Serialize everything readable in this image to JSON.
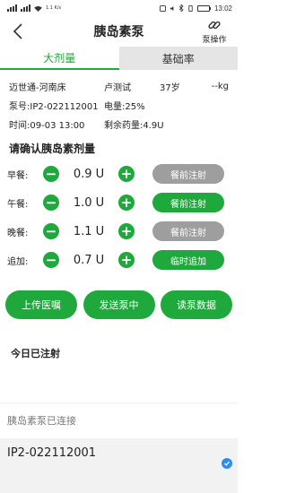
{
  "status_bar": {
    "left_text": "1.1 K/s",
    "time": "13:02",
    "battery_fill": 0.8
  },
  "header": {
    "title": "胰岛素泵",
    "pump_op_label": "泵操作"
  },
  "tabs": [
    {
      "label": "大剂量",
      "active": true
    },
    {
      "label": "基础率",
      "active": false
    }
  ],
  "patient": {
    "name": "迈世通-河南床",
    "test": "卢测试",
    "age": "37岁",
    "weight": "--kg",
    "pump_no": "泵号:IP2-022112001",
    "battery": "电量:25%",
    "time": "时间:09-03 13:00",
    "remaining": "剩余药量:4.9U"
  },
  "dose_section": {
    "title": "请确认胰岛素剂量",
    "rows": [
      {
        "label": "早餐:",
        "value": "0.9",
        "unit": "U",
        "action": "餐前注射",
        "action_state": "gray"
      },
      {
        "label": "午餐:",
        "value": "1.0",
        "unit": "U",
        "action": "餐前注射",
        "action_state": "green"
      },
      {
        "label": "晚餐:",
        "value": "1.1",
        "unit": "U",
        "action": "餐前注射",
        "action_state": "gray"
      },
      {
        "label": "追加:",
        "value": "0.7",
        "unit": "U",
        "action": "临时追加",
        "action_state": "green"
      }
    ],
    "minus": "−",
    "plus": "+"
  },
  "actions": {
    "upload": "上传医嘱",
    "send": "发送泵中",
    "read": "读泵数据"
  },
  "today_title": "今日已注射",
  "overlay": {
    "status": "胰岛素泵已连接",
    "device_id": "IP2-022112001"
  },
  "colors": {
    "accent": "#1fa83b",
    "disabled": "#9e9e9e",
    "check": "#2d8cf0"
  }
}
